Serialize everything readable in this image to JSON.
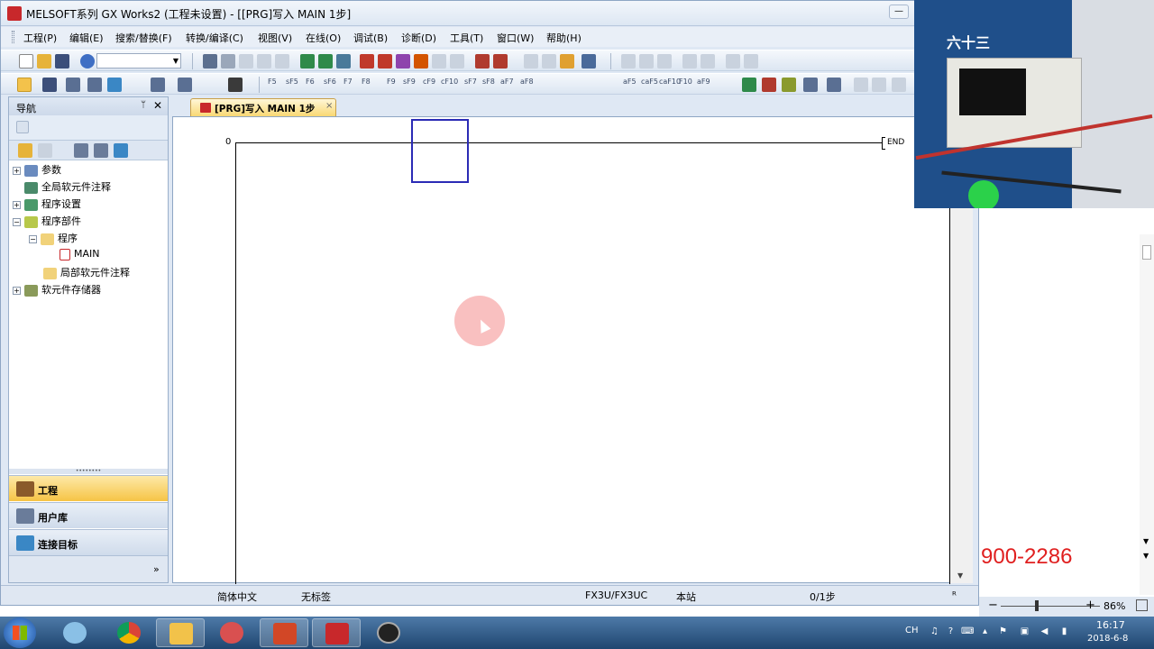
{
  "window": {
    "app_icon": "PLC",
    "title": "MELSOFT系列 GX Works2 (工程未设置) - [[PRG]写入 MAIN 1步]",
    "min": "—",
    "close": "✕"
  },
  "menu": [
    "工程(P)",
    "编辑(E)",
    "搜索/替换(F)",
    "转换/编译(C)",
    "视图(V)",
    "在线(O)",
    "调试(B)",
    "诊断(D)",
    "工具(T)",
    "窗口(W)",
    "帮助(H)"
  ],
  "toolbar2_labels": [
    "F5",
    "sF5",
    "F6",
    "sF6",
    "F7",
    "F8",
    "F9",
    "sF9",
    "cF9",
    "cF10",
    "sF7",
    "sF8",
    "aF7",
    "aF8",
    "aF5",
    "caF5",
    "caF10",
    "F10",
    "aF9"
  ],
  "nav": {
    "title": "导航",
    "pin": "ᛘ",
    "close": "✕",
    "tree": [
      {
        "label": "参数",
        "level": 0,
        "expander": "+"
      },
      {
        "label": "全局软元件注释",
        "level": 0,
        "expander": ""
      },
      {
        "label": "程序设置",
        "level": 0,
        "expander": "+"
      },
      {
        "label": "程序部件",
        "level": 0,
        "expander": "−"
      },
      {
        "label": "程序",
        "level": 1,
        "expander": "−"
      },
      {
        "label": "MAIN",
        "level": 2,
        "expander": ""
      },
      {
        "label": "局部软元件注释",
        "level": 1,
        "expander": ""
      },
      {
        "label": "软元件存储器",
        "level": 0,
        "expander": "+"
      }
    ],
    "buttons": [
      "工程",
      "用户库",
      "连接目标"
    ],
    "more": "»"
  },
  "editor": {
    "tab_label": "[PRG]写入 MAIN 1步",
    "tab_close": "×",
    "rung_number": "0",
    "end_instruction": "END"
  },
  "status": {
    "language": "简体中文",
    "label": "无标签",
    "cpu": "FX3U/FX3UC",
    "station": "本站",
    "steps": "0/1步",
    "extra": "ᴿ"
  },
  "overlay": {
    "webcam_text": "六十三",
    "phone": "900-2286"
  },
  "zoom": {
    "percent": "86%",
    "minus": "−",
    "plus": "+"
  },
  "taskbar": {
    "lang": "CH",
    "time": "16:17",
    "date": "2018-6-8"
  },
  "colors": {
    "accent_tab": "#f9d873",
    "cursor_box": "#2b2bb5",
    "app_icon": "#c8282b"
  }
}
